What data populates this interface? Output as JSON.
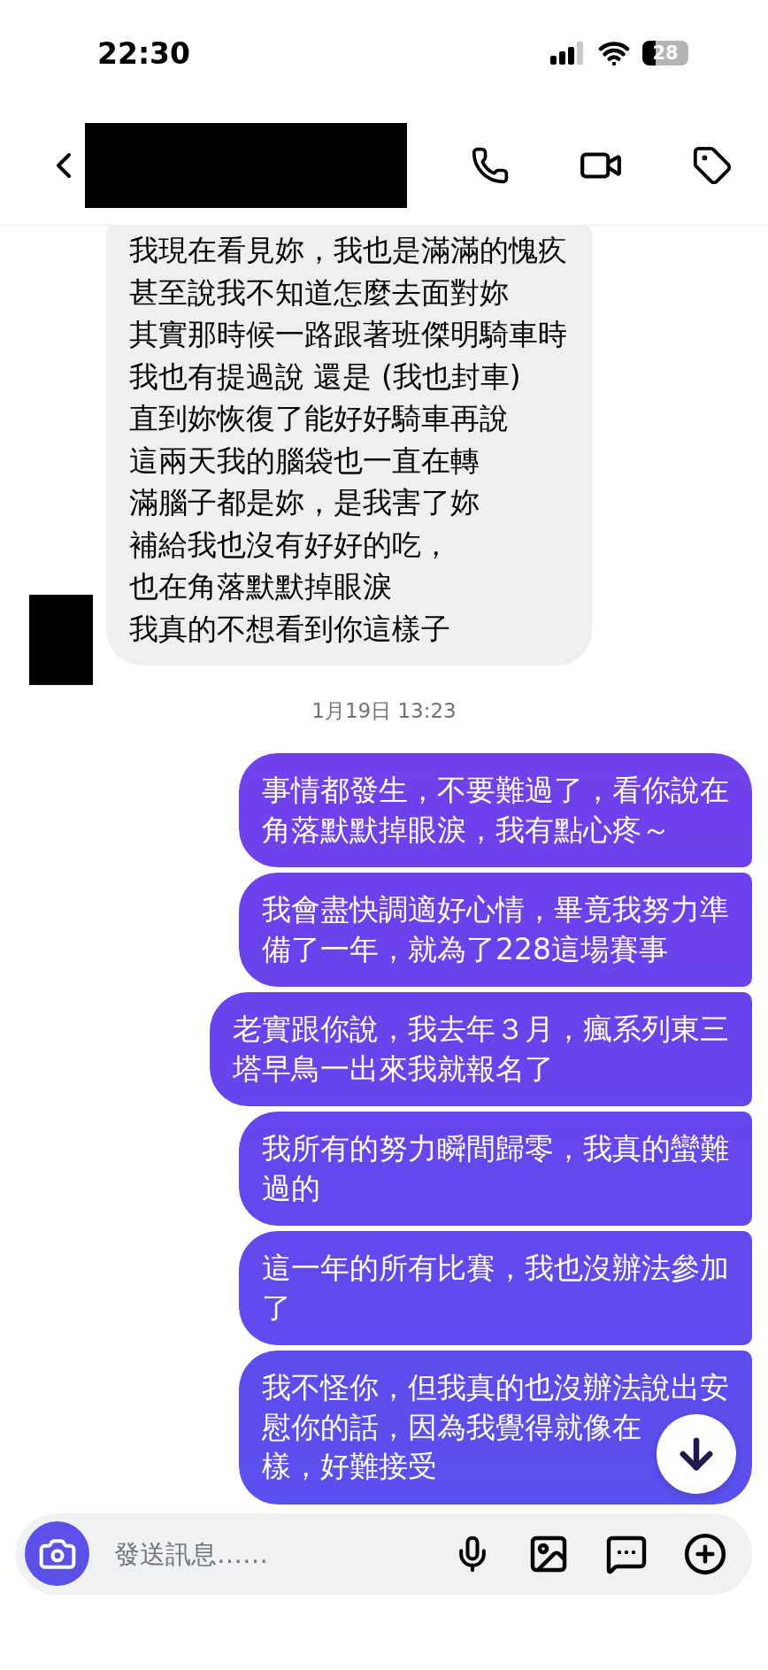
{
  "status_bar": {
    "time": "22:30",
    "battery": "28"
  },
  "conversation": [
    {
      "kind": "received",
      "lines": [
        "我現在看見妳，我也是滿滿的愧疚",
        "甚至說我不知道怎麼去面對妳",
        "其實那時候一路跟著班傑明騎車時",
        "我也有提過說 還是 (我也封車)",
        "直到妳恢復了能好好騎車再說",
        "這兩天我的腦袋也一直在轉",
        "滿腦子都是妳，是我害了妳",
        "補給我也沒有好好的吃，",
        "也在角落默默掉眼淚",
        "我真的不想看到你這樣子"
      ]
    },
    {
      "kind": "timestamp",
      "text": "1月19日 13:23"
    },
    {
      "kind": "sent",
      "lines": [
        "事情都發生，不要難過了，看你說在",
        "角落默默掉眼淚，我有點心疼～"
      ]
    },
    {
      "kind": "sent",
      "lines": [
        "我會盡快調適好心情，畢竟我努力準",
        "備了一年，就為了228這場賽事"
      ]
    },
    {
      "kind": "sent",
      "lines": [
        "老實跟你說，我去年３月，瘋系列東三",
        "塔早鳥一出來我就報名了"
      ]
    },
    {
      "kind": "sent",
      "lines": [
        "我所有的努力瞬間歸零，我真的蠻難",
        "過的"
      ]
    },
    {
      "kind": "sent",
      "lines": [
        "這一年的所有比賽，我也沒辦法參加",
        "了"
      ]
    },
    {
      "kind": "sent",
      "lines": [
        "我不怪你，但我真的也沒辦法說出安",
        "慰你的話，因為我覺得就像在",
        "樣，好難接受"
      ]
    }
  ],
  "composer": {
    "placeholder": "發送訊息……"
  }
}
